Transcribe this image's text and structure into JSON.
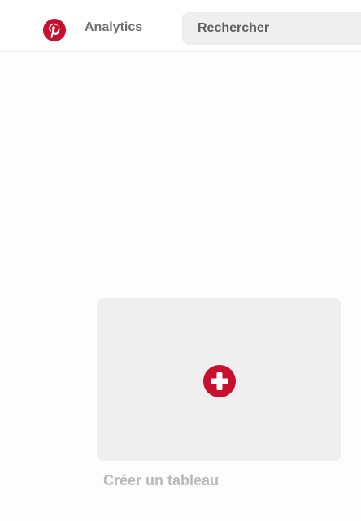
{
  "header": {
    "logo_icon": "pinterest-logo-icon",
    "brand_color": "#c8102e",
    "nav_analytics": "Analytics",
    "search": {
      "placeholder": "Rechercher",
      "value": ""
    }
  },
  "main": {
    "create_board": {
      "icon": "plus-circle-icon",
      "label": "Créer un tableau",
      "accent_color": "#c8102e"
    }
  }
}
